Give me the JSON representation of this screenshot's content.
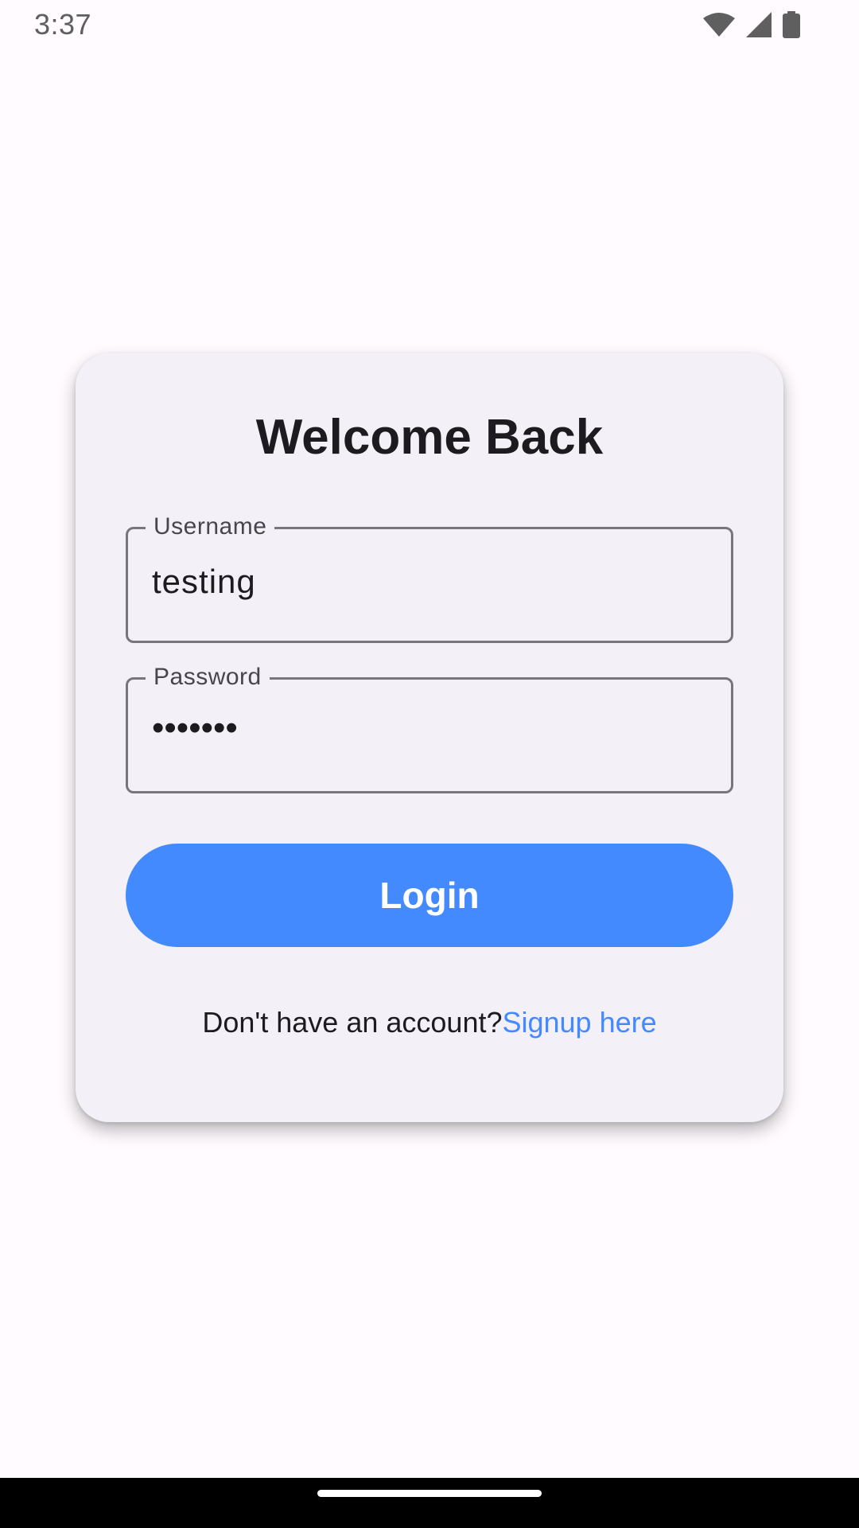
{
  "status_bar": {
    "time": "3:37",
    "icons": [
      "wifi-icon",
      "cellular-signal-icon",
      "battery-icon"
    ]
  },
  "login_card": {
    "title": "Welcome Back",
    "username": {
      "label": "Username",
      "value": "testing"
    },
    "password": {
      "label": "Password",
      "value": "•••••••"
    },
    "login_button_label": "Login",
    "signup_prompt": "Don't have an account?",
    "signup_link": "Signup here"
  },
  "colors": {
    "accent": "#448aff",
    "card_background": "#f4f0f7",
    "page_background": "#fffbfe",
    "field_border": "#79747e"
  }
}
